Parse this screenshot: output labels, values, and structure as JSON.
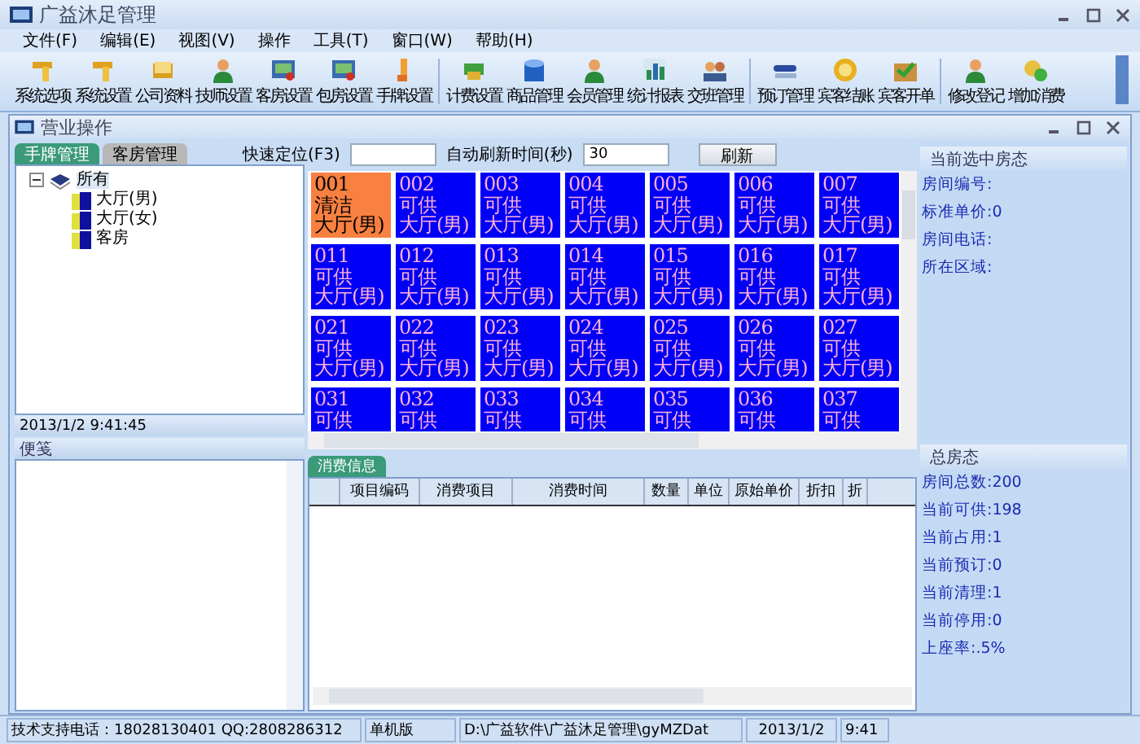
{
  "window": {
    "title": "广益沐足管理"
  },
  "menu": [
    "文件(F)",
    "编辑(E)",
    "视图(V)",
    "操作",
    "工具(T)",
    "窗口(W)",
    "帮助(H)"
  ],
  "toolbar": [
    [
      "系统选项",
      "系统设置",
      "公司资料",
      "技师设置",
      "客房设置",
      "包房设置",
      "手牌设置"
    ],
    [
      "计费设置",
      "商品管理",
      "会员管理",
      "统计报表",
      "交班管理"
    ],
    [
      "预订管理",
      "宾客结账",
      "宾客开单"
    ],
    [
      "修改登记",
      "增加消费"
    ]
  ],
  "child_window": {
    "title": "营业操作"
  },
  "left_panel": {
    "tabs": [
      {
        "label": "手牌管理",
        "selected": true
      },
      {
        "label": "客房管理",
        "selected": false
      }
    ],
    "tree": {
      "label": "所有",
      "expanded": true,
      "selected": true,
      "children": [
        {
          "label": "大厅(男)",
          "selected": false
        },
        {
          "label": "大厅(女)",
          "selected": false
        },
        {
          "label": "客房",
          "selected": false
        }
      ]
    },
    "datetime": "2013/1/2 9:41:45",
    "notes": {
      "title": "便笺"
    }
  },
  "quick_locate": {
    "label": "快速定位(F3)"
  },
  "auto_refresh": {
    "label": "自动刷新时间(秒)",
    "value": "30"
  },
  "refresh_button": "刷新",
  "rooms": [
    {
      "number": "001",
      "status": "清洁",
      "area": "大厅(男)",
      "kind": "cleaning"
    },
    {
      "number": "002",
      "status": "可供",
      "area": "大厅(男)",
      "kind": "available"
    },
    {
      "number": "003",
      "status": "可供",
      "area": "大厅(男)",
      "kind": "available"
    },
    {
      "number": "004",
      "status": "可供",
      "area": "大厅(男)",
      "kind": "available"
    },
    {
      "number": "005",
      "status": "可供",
      "area": "大厅(男)",
      "kind": "available"
    },
    {
      "number": "006",
      "status": "可供",
      "area": "大厅(男)",
      "kind": "available"
    },
    {
      "number": "007",
      "status": "可供",
      "area": "大厅(男)",
      "kind": "available"
    },
    {
      "number": "011",
      "status": "可供",
      "area": "大厅(男)",
      "kind": "available"
    },
    {
      "number": "012",
      "status": "可供",
      "area": "大厅(男)",
      "kind": "available"
    },
    {
      "number": "013",
      "status": "可供",
      "area": "大厅(男)",
      "kind": "available"
    },
    {
      "number": "014",
      "status": "可供",
      "area": "大厅(男)",
      "kind": "available"
    },
    {
      "number": "015",
      "status": "可供",
      "area": "大厅(男)",
      "kind": "available"
    },
    {
      "number": "016",
      "status": "可供",
      "area": "大厅(男)",
      "kind": "available"
    },
    {
      "number": "017",
      "status": "可供",
      "area": "大厅(男)",
      "kind": "available"
    },
    {
      "number": "021",
      "status": "可供",
      "area": "大厅(男)",
      "kind": "available"
    },
    {
      "number": "022",
      "status": "可供",
      "area": "大厅(男)",
      "kind": "available"
    },
    {
      "number": "023",
      "status": "可供",
      "area": "大厅(男)",
      "kind": "available"
    },
    {
      "number": "024",
      "status": "可供",
      "area": "大厅(男)",
      "kind": "available"
    },
    {
      "number": "025",
      "status": "可供",
      "area": "大厅(男)",
      "kind": "available"
    },
    {
      "number": "026",
      "status": "可供",
      "area": "大厅(男)",
      "kind": "available"
    },
    {
      "number": "027",
      "status": "可供",
      "area": "大厅(男)",
      "kind": "available"
    },
    {
      "number": "031",
      "status": "可供",
      "kind": "available"
    },
    {
      "number": "032",
      "status": "可供",
      "kind": "available"
    },
    {
      "number": "033",
      "status": "可供",
      "kind": "available"
    },
    {
      "number": "034",
      "status": "可供",
      "kind": "available"
    },
    {
      "number": "035",
      "status": "可供",
      "kind": "available"
    },
    {
      "number": "036",
      "status": "可供",
      "kind": "available"
    },
    {
      "number": "037",
      "status": "可供",
      "kind": "available"
    }
  ],
  "consumption": {
    "tabs": [
      {
        "label": "消费信息",
        "selected": true
      }
    ],
    "columns": [
      "项目编码",
      "消费项目",
      "消费时间",
      "数量",
      "单位",
      "原始单价",
      "折扣",
      "折"
    ]
  },
  "selected_room": {
    "title": "当前选中房态",
    "fields": [
      "房间编号:",
      "标准单价:0",
      "房间电话:",
      "所在区域:"
    ]
  },
  "room_totals": {
    "title": "总房态",
    "fields": [
      "房间总数:200",
      "当前可供:198",
      "当前占用:1",
      "当前预订:0",
      "当前清理:1",
      "当前停用:0",
      "上座率:.5%"
    ]
  },
  "status_bar": [
    "技术支持电话：18028130401 QQ:2808286312",
    "单机版",
    "D:\\广益软件\\广益沐足管理\\gyMZDat",
    "2013/1/2",
    "9:41"
  ]
}
